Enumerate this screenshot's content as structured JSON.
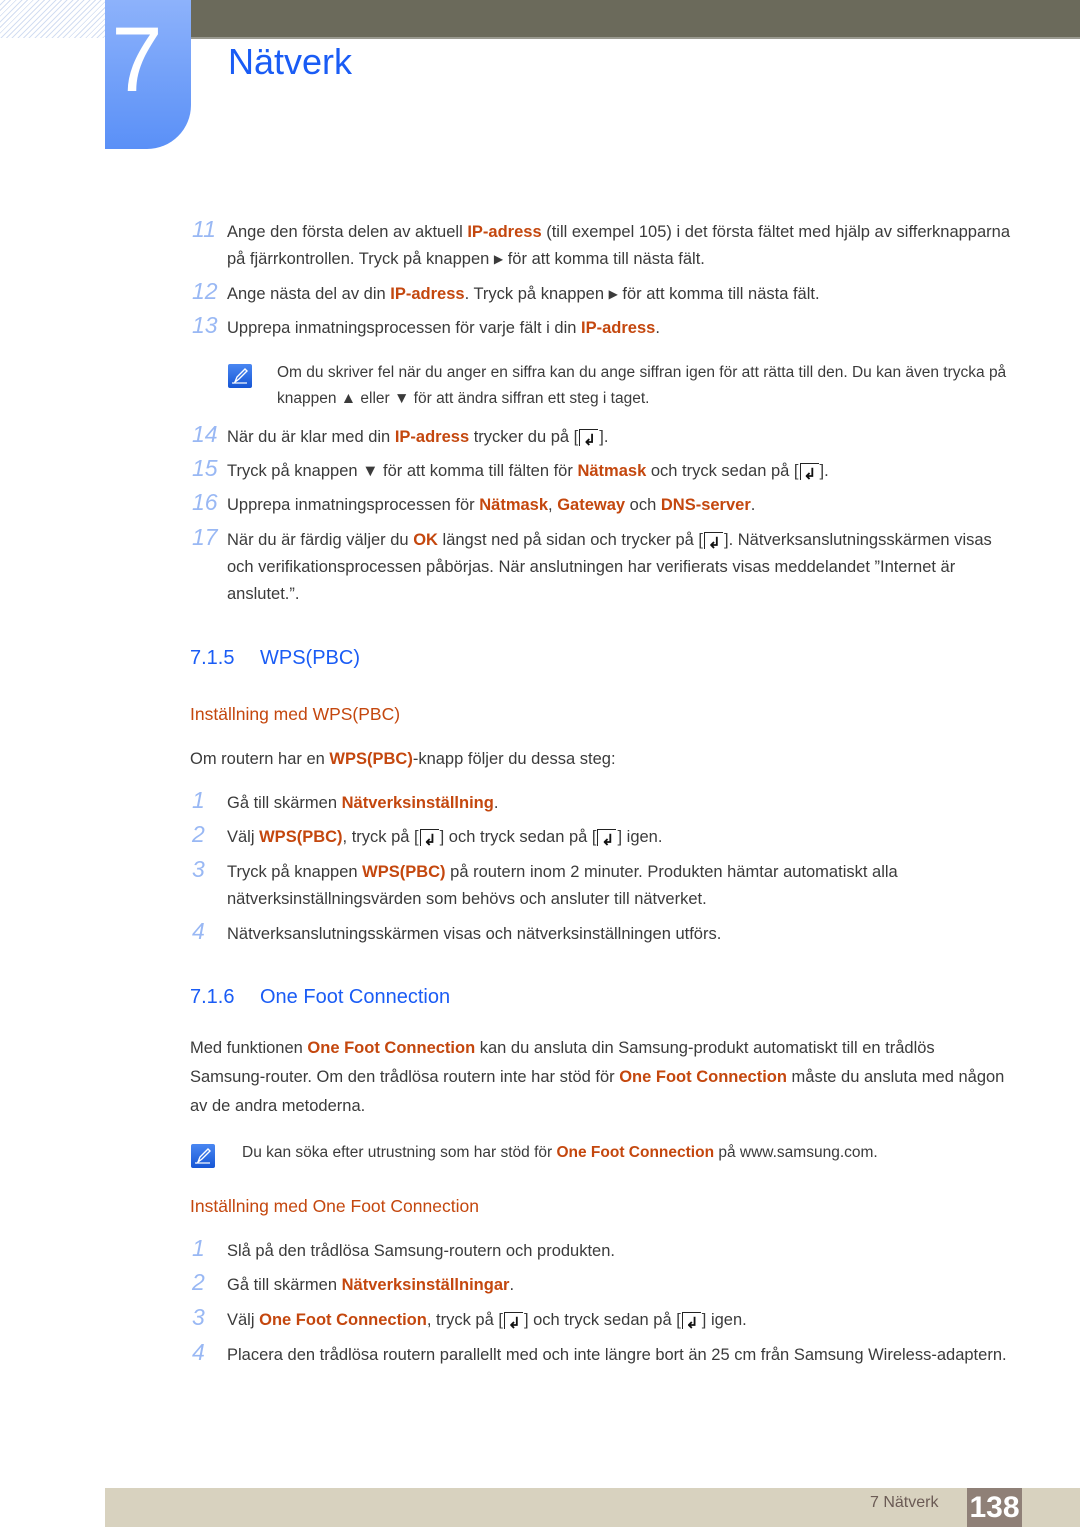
{
  "header": {
    "chapter_number": "7",
    "chapter_title": "Nätverk"
  },
  "steps_a": [
    {
      "num": "11",
      "segments": [
        {
          "t": "Ange den första delen av aktuell "
        },
        {
          "t": "IP-adress",
          "hl": true
        },
        {
          "t": " (till exempel 105) i det första fältet med hjälp av sifferknapparna på fjärrkontrollen. Tryck på knappen "
        },
        {
          "t": "▶",
          "icon": "right-arrow"
        },
        {
          "t": " för att komma till nästa fält."
        }
      ]
    },
    {
      "num": "12",
      "segments": [
        {
          "t": "Ange nästa del av din "
        },
        {
          "t": "IP-adress",
          "hl": true
        },
        {
          "t": ". Tryck på knappen "
        },
        {
          "t": "▶",
          "icon": "right-arrow"
        },
        {
          "t": " för att komma till nästa fält."
        }
      ]
    },
    {
      "num": "13",
      "segments": [
        {
          "t": "Upprepa inmatningsprocessen för varje fält i din "
        },
        {
          "t": "IP-adress",
          "hl": true
        },
        {
          "t": "."
        }
      ]
    }
  ],
  "note_1": "Om du skriver fel när du anger en siffra kan du ange siffran igen för att rätta till den. Du kan även trycka på knappen ▲ eller ▼ för att ändra siffran ett steg i taget.",
  "steps_b": [
    {
      "num": "14",
      "segments": [
        {
          "t": "När du är klar med din "
        },
        {
          "t": "IP-adress",
          "hl": true
        },
        {
          "t": " trycker du på ["
        },
        {
          "key": true
        },
        {
          "t": "]."
        }
      ]
    },
    {
      "num": "15",
      "segments": [
        {
          "t": "Tryck på knappen ▼ för att komma till fälten för "
        },
        {
          "t": "Nätmask",
          "hl": true
        },
        {
          "t": " och tryck sedan på ["
        },
        {
          "key": true
        },
        {
          "t": "]."
        }
      ]
    },
    {
      "num": "16",
      "segments": [
        {
          "t": "Upprepa inmatningsprocessen för "
        },
        {
          "t": "Nätmask",
          "hl": true
        },
        {
          "t": ", "
        },
        {
          "t": "Gateway",
          "hl": true
        },
        {
          "t": " och "
        },
        {
          "t": "DNS-server",
          "hl": true
        },
        {
          "t": "."
        }
      ]
    },
    {
      "num": "17",
      "segments": [
        {
          "t": "När du är färdig väljer du "
        },
        {
          "t": "OK",
          "hl": true
        },
        {
          "t": " längst ned på sidan och trycker på ["
        },
        {
          "key": true
        },
        {
          "t": "]. Nätverksanslutningsskärmen visas och verifikationsprocessen påbörjas. När anslutningen har verifierats visas meddelandet ”Internet är anslutet.”."
        }
      ]
    }
  ],
  "section_715": {
    "number": "7.1.5",
    "title": "WPS(PBC)",
    "subheading": "Inställning med WPS(PBC)",
    "intro": [
      {
        "t": "Om routern har en "
      },
      {
        "t": "WPS(PBC)",
        "hl": true
      },
      {
        "t": "-knapp följer du dessa steg:"
      }
    ],
    "steps": [
      {
        "num": "1",
        "segments": [
          {
            "t": "Gå till skärmen "
          },
          {
            "t": "Nätverksinställning",
            "hl": true
          },
          {
            "t": "."
          }
        ]
      },
      {
        "num": "2",
        "segments": [
          {
            "t": "Välj "
          },
          {
            "t": "WPS(PBC)",
            "hl": true
          },
          {
            "t": ", tryck på ["
          },
          {
            "key": true
          },
          {
            "t": "] och tryck sedan på ["
          },
          {
            "key": true
          },
          {
            "t": "] igen."
          }
        ]
      },
      {
        "num": "3",
        "segments": [
          {
            "t": "Tryck på knappen "
          },
          {
            "t": "WPS(PBC)",
            "hl": true
          },
          {
            "t": " på routern inom 2 minuter. Produkten hämtar automatiskt alla nätverksinställningsvärden som behövs och ansluter till nätverket."
          }
        ]
      },
      {
        "num": "4",
        "segments": [
          {
            "t": "Nätverksanslutningsskärmen visas och nätverksinställningen utförs."
          }
        ]
      }
    ]
  },
  "section_716": {
    "number": "7.1.6",
    "title": "One Foot Connection",
    "intro": [
      {
        "t": "Med funktionen "
      },
      {
        "t": "One Foot Connection",
        "hl": true
      },
      {
        "t": " kan du ansluta din Samsung-produkt automatiskt till en trådlös Samsung-router. Om den trådlösa routern inte har stöd för "
      },
      {
        "t": "One Foot Connection",
        "hl": true
      },
      {
        "t": " måste du ansluta med någon av de andra metoderna."
      }
    ],
    "note": [
      {
        "t": "Du kan söka efter utrustning som har stöd för "
      },
      {
        "t": "One Foot Connection",
        "hl": true
      },
      {
        "t": " på www.samsung.com."
      }
    ],
    "subheading": "Inställning med One Foot Connection",
    "steps": [
      {
        "num": "1",
        "segments": [
          {
            "t": "Slå på den trådlösa Samsung-routern och produkten."
          }
        ]
      },
      {
        "num": "2",
        "segments": [
          {
            "t": "Gå till skärmen "
          },
          {
            "t": "Nätverksinställningar",
            "hl": true
          },
          {
            "t": "."
          }
        ]
      },
      {
        "num": "3",
        "segments": [
          {
            "t": "Välj "
          },
          {
            "t": "One Foot Connection",
            "hl": true
          },
          {
            "t": ", tryck på ["
          },
          {
            "key": true
          },
          {
            "t": "] och tryck sedan på ["
          },
          {
            "key": true
          },
          {
            "t": "] igen."
          }
        ]
      },
      {
        "num": "4",
        "segments": [
          {
            "t": "Placera den trådlösa routern parallellt med och inte längre bort än 25 cm från Samsung Wireless-adaptern."
          }
        ]
      }
    ]
  },
  "footer": {
    "chapter_label": "7 Nätverk",
    "page_number": "138"
  },
  "colors": {
    "accent_blue": "#1a5cf5",
    "highlight_orange": "#c4470e",
    "step_number_blue": "#99b8f4",
    "footer_bg": "#d8d2bf",
    "page_box_bg": "#8f8077"
  }
}
